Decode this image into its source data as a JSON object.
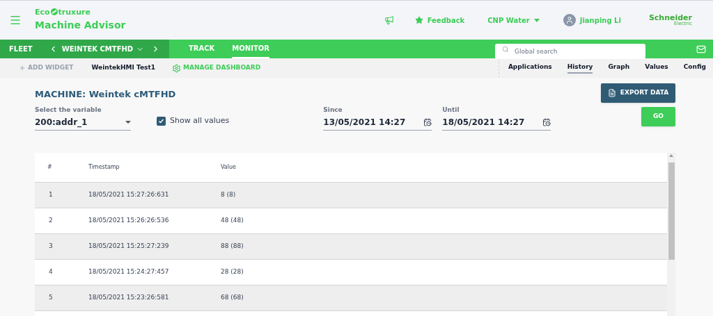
{
  "header": {
    "brand_left": "Eco",
    "brand_right": "truxure",
    "app_name": "Machine Advisor",
    "feedback": "Feedback",
    "org": "CNP Water",
    "user": "Jianping Li",
    "vendor_top": "Schneider",
    "vendor_bottom": "Electric"
  },
  "navbar": {
    "fleet": "FLEET",
    "machine": "WEINTEK CMTFHD",
    "tabs": [
      {
        "label": "TRACK",
        "selected": false
      },
      {
        "label": "MONITOR",
        "selected": true
      }
    ],
    "search": {
      "placeholder": "Global search"
    }
  },
  "toolbar": {
    "add_widget": "ADD WIDGET",
    "dashboard": "WeintekHMI Test1",
    "manage": "MANAGE DASHBOARD",
    "tabs": [
      {
        "label": "Applications",
        "selected": false
      },
      {
        "label": "History",
        "selected": true
      },
      {
        "label": "Graph",
        "selected": false
      },
      {
        "label": "Values",
        "selected": false
      },
      {
        "label": "Config",
        "selected": false
      }
    ]
  },
  "main": {
    "title": "MACHINE: Weintek cMTFHD",
    "export": "EXPORT DATA",
    "go": "GO",
    "variable": {
      "label": "Select the variable",
      "value": "200:addr_1"
    },
    "show_all": {
      "label": "Show all values",
      "checked": true
    },
    "since": {
      "label": "Since",
      "value": "13/05/2021 14:27"
    },
    "until": {
      "label": "Until",
      "value": "18/05/2021 14:27"
    }
  },
  "table": {
    "columns": [
      "#",
      "Timestamp",
      "Value"
    ],
    "rows": [
      [
        "1",
        "18/05/2021 15:27:26:631",
        "8 (8)"
      ],
      [
        "2",
        "18/05/2021 15:26:26:536",
        "48 (48)"
      ],
      [
        "3",
        "18/05/2021 15:25:27:239",
        "88 (88)"
      ],
      [
        "4",
        "18/05/2021 15:24:27:457",
        "28 (28)"
      ],
      [
        "5",
        "18/05/2021 15:23:26:581",
        "68 (68)"
      ]
    ]
  }
}
